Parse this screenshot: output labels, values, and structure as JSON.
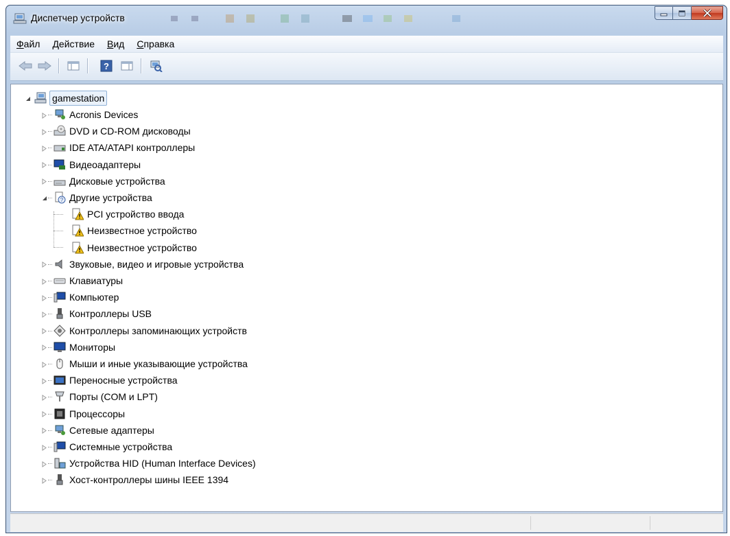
{
  "window": {
    "title": "Диспетчер устройств",
    "title_icon": "computer-device-manager-icon",
    "caption_buttons": [
      {
        "name": "minimize-button",
        "icon": "minimize-icon"
      },
      {
        "name": "maximize-button",
        "icon": "maximize-icon"
      },
      {
        "name": "close-button",
        "icon": "close-x-icon"
      }
    ]
  },
  "menu": {
    "items": [
      {
        "accel": "Ф",
        "rest": "айл"
      },
      {
        "accel": "Д",
        "rest": "ействие"
      },
      {
        "accel": "В",
        "rest": "ид"
      },
      {
        "accel": "С",
        "rest": "правка"
      }
    ]
  },
  "toolbar": {
    "buttons": [
      {
        "name": "back-button",
        "icon": "arrow-left-icon"
      },
      {
        "name": "forward-button",
        "icon": "arrow-right-icon"
      },
      {
        "name": "show-hide-tree-button",
        "icon": "console-tree-icon"
      },
      {
        "name": "help-button",
        "icon": "help-icon"
      },
      {
        "name": "properties-button",
        "icon": "properties-icon"
      },
      {
        "name": "scan-hardware-button",
        "icon": "scan-hardware-icon"
      }
    ]
  },
  "tree": {
    "root": {
      "label": "gamestation",
      "icon": "computer-icon",
      "expanded": true
    },
    "items": [
      {
        "label": "Acronis Devices",
        "icon": "network-device-icon",
        "expanded": false,
        "level": 1
      },
      {
        "label": "DVD и CD-ROM дисководы",
        "icon": "dvd-drive-icon",
        "expanded": false,
        "level": 1
      },
      {
        "label": "IDE ATA/ATAPI контроллеры",
        "icon": "ide-controller-icon",
        "expanded": false,
        "level": 1
      },
      {
        "label": "Видеоадаптеры",
        "icon": "display-adapter-icon",
        "expanded": false,
        "level": 1
      },
      {
        "label": "Дисковые устройства",
        "icon": "disk-drive-icon",
        "expanded": false,
        "level": 1
      },
      {
        "label": "Другие устройства",
        "icon": "unknown-device-icon",
        "expanded": true,
        "level": 1
      },
      {
        "label": "PCI устройство ввода",
        "icon": "warning-device-icon",
        "level": 2
      },
      {
        "label": "Неизвестное устройство",
        "icon": "warning-device-icon",
        "level": 2
      },
      {
        "label": "Неизвестное устройство",
        "icon": "warning-device-icon",
        "level": 2
      },
      {
        "label": "Звуковые, видео и игровые устройства",
        "icon": "speaker-icon",
        "expanded": false,
        "level": 1
      },
      {
        "label": "Клавиатуры",
        "icon": "keyboard-icon",
        "expanded": false,
        "level": 1
      },
      {
        "label": "Компьютер",
        "icon": "computer-monitor-icon",
        "expanded": false,
        "level": 1
      },
      {
        "label": "Контроллеры USB",
        "icon": "usb-icon",
        "expanded": false,
        "level": 1
      },
      {
        "label": "Контроллеры запоминающих устройств",
        "icon": "storage-controller-icon",
        "expanded": false,
        "level": 1
      },
      {
        "label": "Мониторы",
        "icon": "monitor-icon",
        "expanded": false,
        "level": 1
      },
      {
        "label": "Мыши и иные указывающие устройства",
        "icon": "mouse-icon",
        "expanded": false,
        "level": 1
      },
      {
        "label": "Переносные устройства",
        "icon": "portable-device-icon",
        "expanded": false,
        "level": 1
      },
      {
        "label": "Порты (COM и LPT)",
        "icon": "port-icon",
        "expanded": false,
        "level": 1
      },
      {
        "label": "Процессоры",
        "icon": "processor-icon",
        "expanded": false,
        "level": 1
      },
      {
        "label": "Сетевые адаптеры",
        "icon": "network-adapter-icon",
        "expanded": false,
        "level": 1
      },
      {
        "label": "Системные устройства",
        "icon": "system-device-icon",
        "expanded": false,
        "level": 1
      },
      {
        "label": "Устройства HID (Human Interface Devices)",
        "icon": "hid-icon",
        "expanded": false,
        "level": 1
      },
      {
        "label": "Хост-контроллеры шины IEEE 1394",
        "icon": "firewire-icon",
        "expanded": false,
        "level": 1
      }
    ]
  },
  "colors": {
    "selection_border": "#8fb1d6",
    "warning_yellow": "#f2c21b",
    "titlebar": "#c9daee"
  }
}
